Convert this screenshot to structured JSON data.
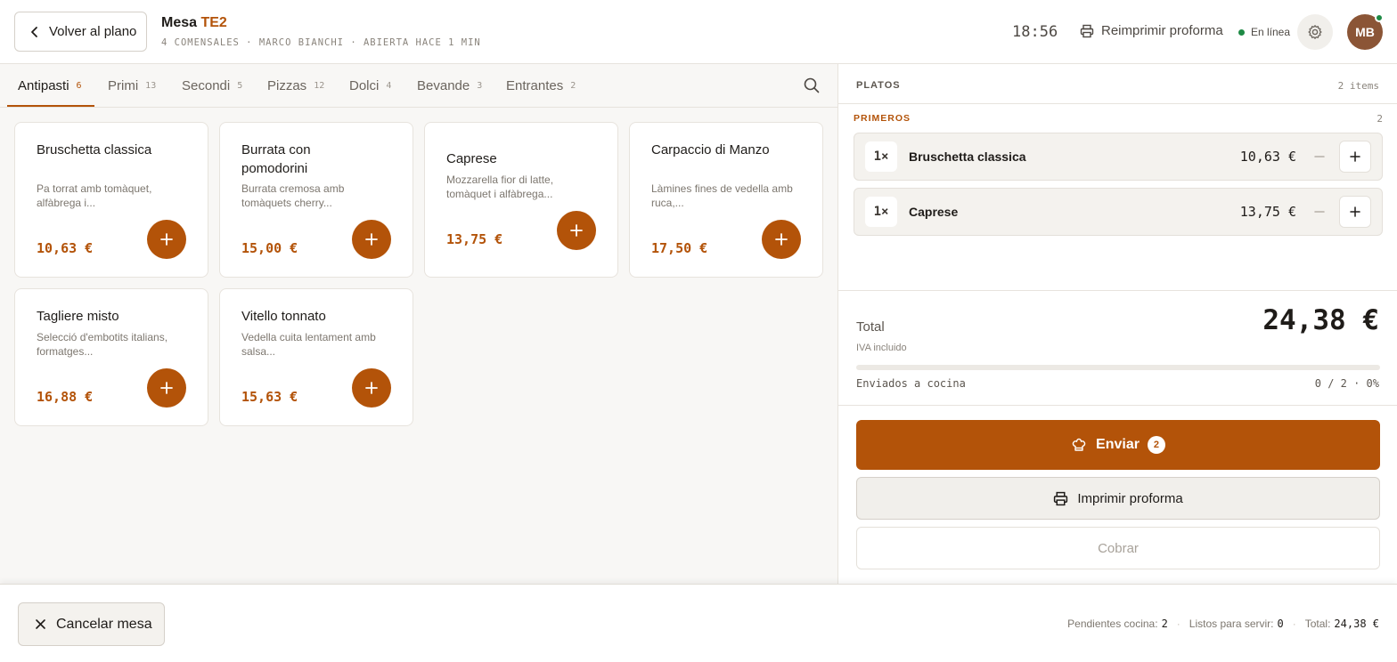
{
  "header": {
    "back_label": "Volver al plano",
    "table_prefix": "Mesa",
    "table_code": "TE2",
    "subtitle": "4 COMENSALES · MARCO BIANCHI · ABIERTA HACE 1 MIN",
    "clock": "18:56",
    "reprint_label": "Reimprimir proforma",
    "online_label": "En línea",
    "avatar_initials": "MB"
  },
  "tabs": [
    {
      "label": "Antipasti",
      "count": "6"
    },
    {
      "label": "Primi",
      "count": "13"
    },
    {
      "label": "Secondi",
      "count": "5"
    },
    {
      "label": "Pizzas",
      "count": "12"
    },
    {
      "label": "Dolci",
      "count": "4"
    },
    {
      "label": "Bevande",
      "count": "3"
    },
    {
      "label": "Entrantes",
      "count": "2"
    }
  ],
  "products": [
    {
      "name": "Bruschetta classica",
      "desc": "Pa torrat amb tomàquet, alfàbrega i...",
      "price": "10,63 €"
    },
    {
      "name": "Burrata con pomodorini",
      "desc": "Burrata cremosa amb tomàquets cherry...",
      "price": "15,00 €"
    },
    {
      "name": "Caprese",
      "desc": "Mozzarella fior di latte, tomàquet i alfàbrega...",
      "price": "13,75 €"
    },
    {
      "name": "Carpaccio di Manzo",
      "desc": "Làmines fines de vedella amb ruca,...",
      "price": "17,50 €"
    },
    {
      "name": "Tagliere misto",
      "desc": "Selecció d'embotits italians, formatges...",
      "price": "16,88 €"
    },
    {
      "name": "Vitello tonnato",
      "desc": "Vedella cuita lentament amb salsa...",
      "price": "15,63 €"
    }
  ],
  "order": {
    "heading": "PLATOS",
    "items_count": "2 items",
    "group_title": "PRIMEROS",
    "group_count": "2",
    "lines": [
      {
        "qty": "1×",
        "name": "Bruschetta classica",
        "price": "10,63 €"
      },
      {
        "qty": "1×",
        "name": "Caprese",
        "price": "13,75 €"
      }
    ],
    "total_label": "Total",
    "total_value": "24,38 €",
    "vat_note": "IVA incluido",
    "sent_label": "Enviados a cocina",
    "sent_value": "0 / 2 · 0%",
    "sent_progress": 0,
    "send_label": "Enviar",
    "send_badge": "2",
    "print_label": "Imprimir proforma",
    "charge_label": "Cobrar"
  },
  "footer": {
    "cancel_label": "Cancelar mesa",
    "pending_label": "Pendientes cocina:",
    "pending_value": "2",
    "ready_label": "Listos para servir:",
    "ready_value": "0",
    "total_label": "Total:",
    "total_value": "24,38 €"
  },
  "colors": {
    "accent": "#b35309",
    "online": "#1e8a45",
    "avatar": "#8b5536"
  }
}
